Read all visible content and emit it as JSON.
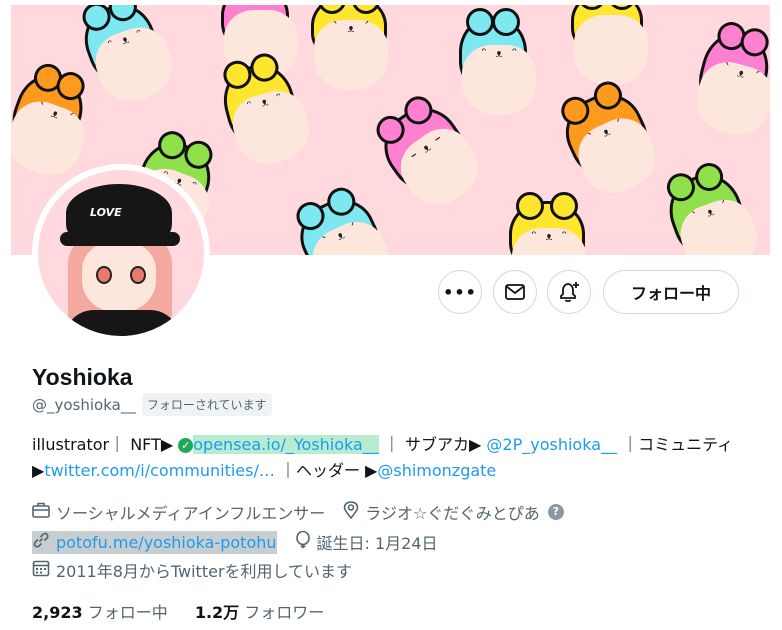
{
  "profile": {
    "display_name": "Yoshioka",
    "handle": "@_yoshioka__",
    "follows_you_badge": "フォローされています",
    "avatar_cap_text": "LOVE"
  },
  "actions": {
    "more_icon": "more-icon",
    "message_icon": "envelope-icon",
    "notify_icon": "bell-plus-icon",
    "follow_label": "フォロー中"
  },
  "bio": {
    "part1": "illustrator｜ NFT▶",
    "check_icon": "verified-check-icon",
    "opensea_link": "opensea.io/_Yoshioka__",
    "part2": " ｜ サブアカ▶",
    "sub_link": "@2P_yoshioka__",
    "part3": " ｜コミュニティ▶",
    "community_link": "twitter.com/i/communities/…",
    "part4": " ｜ヘッダー ▶",
    "header_link": "@shimonzgate"
  },
  "meta": {
    "category": "ソーシャルメディアインフルエンサー",
    "location": "ラジオ☆ぐだぐみとぴあ",
    "website": "potofu.me/yoshioka-potohu",
    "birthday": "誕生日: 1月24日",
    "joined": "2011年8月からTwitterを利用しています"
  },
  "stats": {
    "following_count": "2,923",
    "following_label": "フォロー中",
    "followers_count": "1.2万",
    "followers_label": "フォロワー"
  },
  "colors": {
    "banner_bg": "#ffd9dd",
    "link": "#1d9bf0",
    "muted": "#536471"
  }
}
